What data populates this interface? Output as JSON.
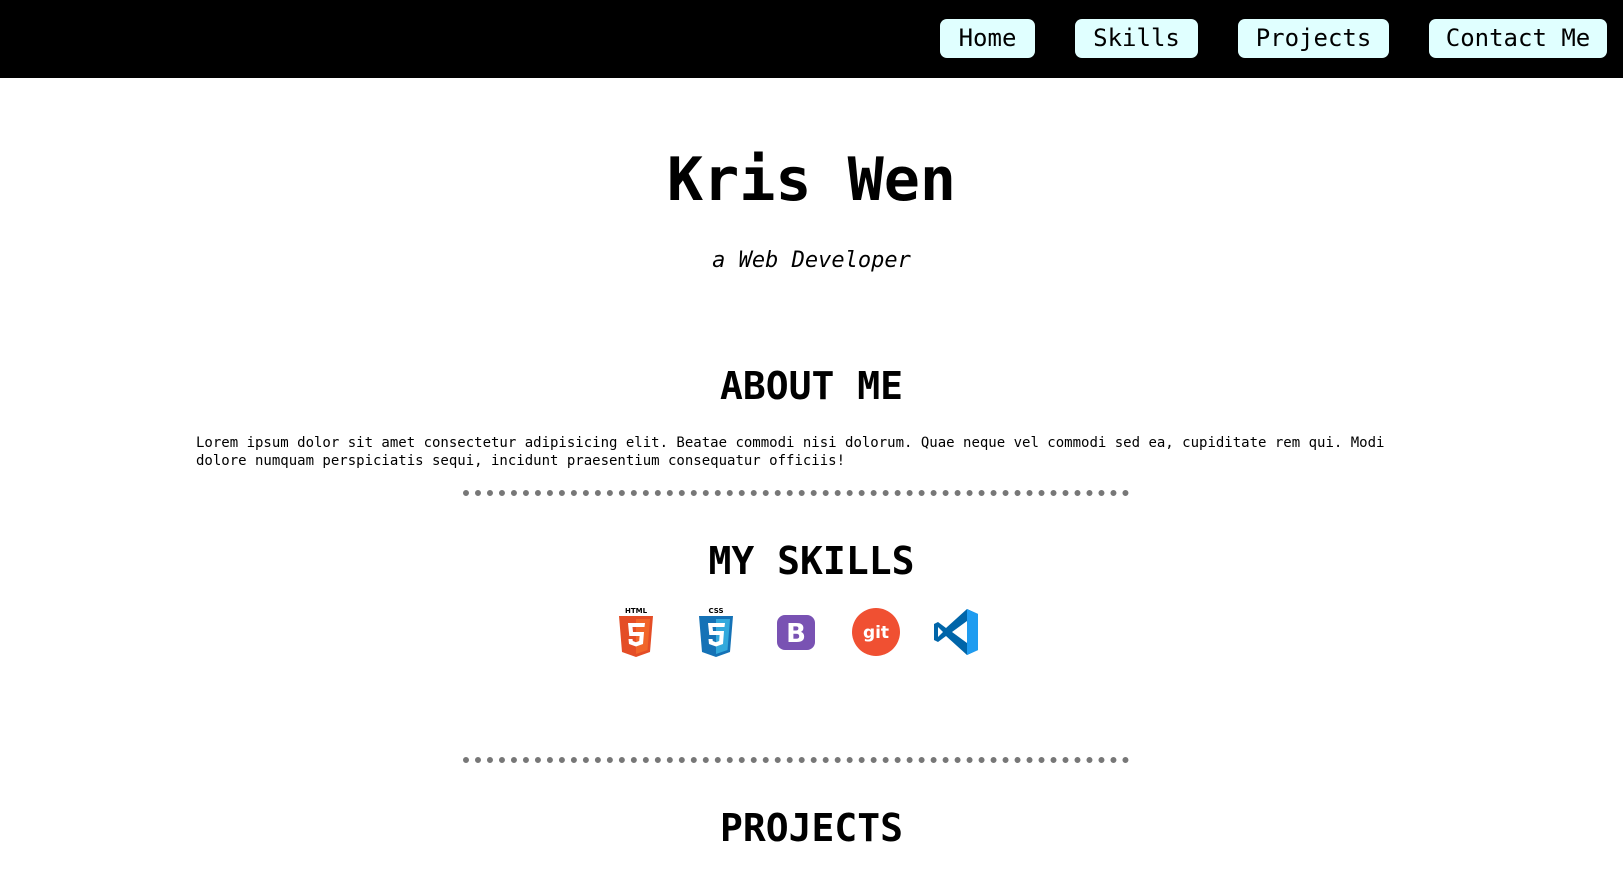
{
  "nav": {
    "items": [
      {
        "label": "Home"
      },
      {
        "label": "Skills"
      },
      {
        "label": "Projects"
      },
      {
        "label": "Contact Me"
      }
    ],
    "button_color": "#e0ffff",
    "bar_color": "#000000"
  },
  "hero": {
    "name": "Kris Wen",
    "subtitle": "a Web Developer"
  },
  "about": {
    "title": "ABOUT ME",
    "text": "Lorem ipsum dolor sit amet consectetur adipisicing elit. Beatae commodi nisi dolorum. Quae neque vel commodi sed ea, cupiditate rem qui. Modi dolore numquam perspiciatis sequi, incidunt praesentium consequatur officiis!"
  },
  "skills": {
    "title": "MY SKILLS",
    "icons": [
      {
        "icon": "html5-icon",
        "label": "HTML",
        "color": "#e44d26"
      },
      {
        "icon": "css3-icon",
        "label": "CSS",
        "color": "#1572b6"
      },
      {
        "icon": "bootstrap-icon",
        "label": "B",
        "color": "#7952b3"
      },
      {
        "icon": "git-icon",
        "label": "git",
        "color": "#f05032"
      },
      {
        "icon": "vscode-icon",
        "color": "#007acc"
      }
    ]
  },
  "projects": {
    "title": "PROJECTS"
  }
}
